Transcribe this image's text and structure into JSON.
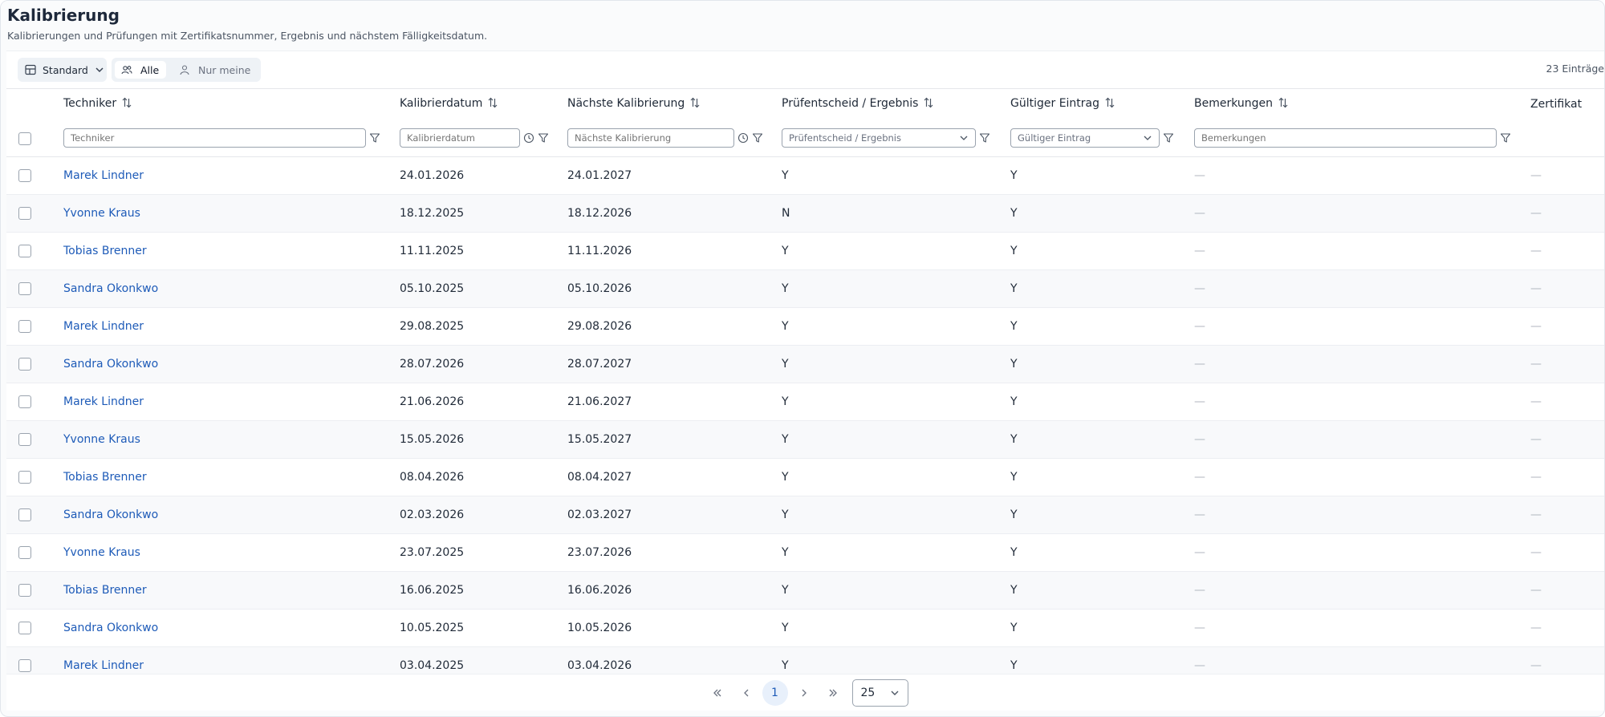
{
  "page": {
    "title": "Kalibrierung",
    "subtitle": "Kalibrierungen und Prüfungen mit Zertifikatsnummer, Ergebnis und nächstem Fälligkeitsdatum."
  },
  "toolbar": {
    "view_label": "Standard",
    "filter_all": "Alle",
    "filter_mine": "Nur meine",
    "count": "23 Einträge"
  },
  "columns": {
    "technician": "Techniker",
    "cal_date": "Kalibrierdatum",
    "next_cal": "Nächste Kalibrierung",
    "result": "Prüfentscheid / Ergebnis",
    "valid": "Gültiger Eintrag",
    "remarks": "Bemerkungen",
    "certificate": "Zertifikat"
  },
  "filters": {
    "technician": "Techniker",
    "cal_date": "Kalibrierdatum",
    "next_cal": "Nächste Kalibrierung",
    "result": "Prüfentscheid / Ergebnis",
    "valid": "Gültiger Eintrag",
    "remarks": "Bemerkungen"
  },
  "rows": [
    {
      "technician": "Marek Lindner",
      "cal_date": "24.01.2026",
      "next_cal": "24.01.2027",
      "result": "Y",
      "valid": "Y",
      "remarks": "—",
      "certificate": "—"
    },
    {
      "technician": "Yvonne Kraus",
      "cal_date": "18.12.2025",
      "next_cal": "18.12.2026",
      "result": "N",
      "valid": "Y",
      "remarks": "—",
      "certificate": "—"
    },
    {
      "technician": "Tobias Brenner",
      "cal_date": "11.11.2025",
      "next_cal": "11.11.2026",
      "result": "Y",
      "valid": "Y",
      "remarks": "—",
      "certificate": "—"
    },
    {
      "technician": "Sandra Okonkwo",
      "cal_date": "05.10.2025",
      "next_cal": "05.10.2026",
      "result": "Y",
      "valid": "Y",
      "remarks": "—",
      "certificate": "—"
    },
    {
      "technician": "Marek Lindner",
      "cal_date": "29.08.2025",
      "next_cal": "29.08.2026",
      "result": "Y",
      "valid": "Y",
      "remarks": "—",
      "certificate": "—"
    },
    {
      "technician": "Sandra Okonkwo",
      "cal_date": "28.07.2026",
      "next_cal": "28.07.2027",
      "result": "Y",
      "valid": "Y",
      "remarks": "—",
      "certificate": "—"
    },
    {
      "technician": "Marek Lindner",
      "cal_date": "21.06.2026",
      "next_cal": "21.06.2027",
      "result": "Y",
      "valid": "Y",
      "remarks": "—",
      "certificate": "—"
    },
    {
      "technician": "Yvonne Kraus",
      "cal_date": "15.05.2026",
      "next_cal": "15.05.2027",
      "result": "Y",
      "valid": "Y",
      "remarks": "—",
      "certificate": "—"
    },
    {
      "technician": "Tobias Brenner",
      "cal_date": "08.04.2026",
      "next_cal": "08.04.2027",
      "result": "Y",
      "valid": "Y",
      "remarks": "—",
      "certificate": "—"
    },
    {
      "technician": "Sandra Okonkwo",
      "cal_date": "02.03.2026",
      "next_cal": "02.03.2027",
      "result": "Y",
      "valid": "Y",
      "remarks": "—",
      "certificate": "—"
    },
    {
      "technician": "Yvonne Kraus",
      "cal_date": "23.07.2025",
      "next_cal": "23.07.2026",
      "result": "Y",
      "valid": "Y",
      "remarks": "—",
      "certificate": "—"
    },
    {
      "technician": "Tobias Brenner",
      "cal_date": "16.06.2025",
      "next_cal": "16.06.2026",
      "result": "Y",
      "valid": "Y",
      "remarks": "—",
      "certificate": "—"
    },
    {
      "technician": "Sandra Okonkwo",
      "cal_date": "10.05.2025",
      "next_cal": "10.05.2026",
      "result": "Y",
      "valid": "Y",
      "remarks": "—",
      "certificate": "—"
    },
    {
      "technician": "Marek Lindner",
      "cal_date": "03.04.2025",
      "next_cal": "03.04.2026",
      "result": "Y",
      "valid": "Y",
      "remarks": "—",
      "certificate": "—"
    }
  ],
  "pagination": {
    "current_page": "1",
    "per_page": "25"
  },
  "icons": {
    "view": "table-grid-icon",
    "all": "users-icon",
    "mine": "user-icon",
    "sort": "sort-arrows-icon",
    "filter": "funnel-icon",
    "clock": "clock-icon"
  },
  "colors": {
    "link": "#1e5bb8",
    "accent_bg": "#e8f0fb"
  }
}
